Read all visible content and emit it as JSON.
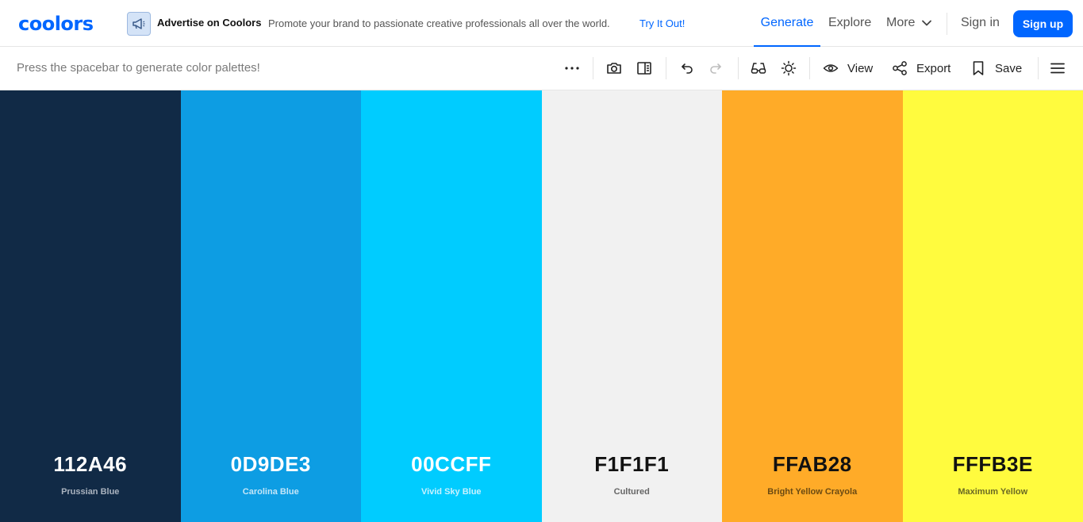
{
  "header": {
    "logo": "coolors",
    "ad": {
      "title": "Advertise on Coolors",
      "text": "Promote your brand to passionate creative professionals all over the world.",
      "link": "Try It Out!"
    },
    "nav": {
      "generate": "Generate",
      "explore": "Explore",
      "more": "More",
      "signin": "Sign in",
      "signup": "Sign up"
    }
  },
  "toolbar": {
    "hint": "Press the spacebar to generate color palettes!",
    "view_label": "View",
    "export_label": "Export",
    "save_label": "Save"
  },
  "palette": [
    {
      "hex": "112A46",
      "name": "Prussian Blue",
      "color": "#112A46",
      "hex_color": "#ffffff",
      "name_color": "#aab3bf"
    },
    {
      "hex": "0D9DE3",
      "name": "Carolina Blue",
      "color": "#0D9DE3",
      "hex_color": "#ffffff",
      "name_color": "#c4e6f8"
    },
    {
      "hex": "00CCFF",
      "name": "Vivid Sky Blue",
      "color": "#00CCFF",
      "hex_color": "#ffffff",
      "name_color": "#c8f1ff"
    },
    {
      "hex": "F1F1F1",
      "name": "Cultured",
      "color": "#F1F1F1",
      "hex_color": "#111111",
      "name_color": "#666666"
    },
    {
      "hex": "FFAB28",
      "name": "Bright Yellow Crayola",
      "color": "#FFAB28",
      "hex_color": "#111111",
      "name_color": "#6b4a12"
    },
    {
      "hex": "FFFB3E",
      "name": "Maximum Yellow",
      "color": "#FFFB3E",
      "hex_color": "#111111",
      "name_color": "#6b6a24"
    }
  ],
  "colors": {
    "accent": "#0066ff"
  }
}
